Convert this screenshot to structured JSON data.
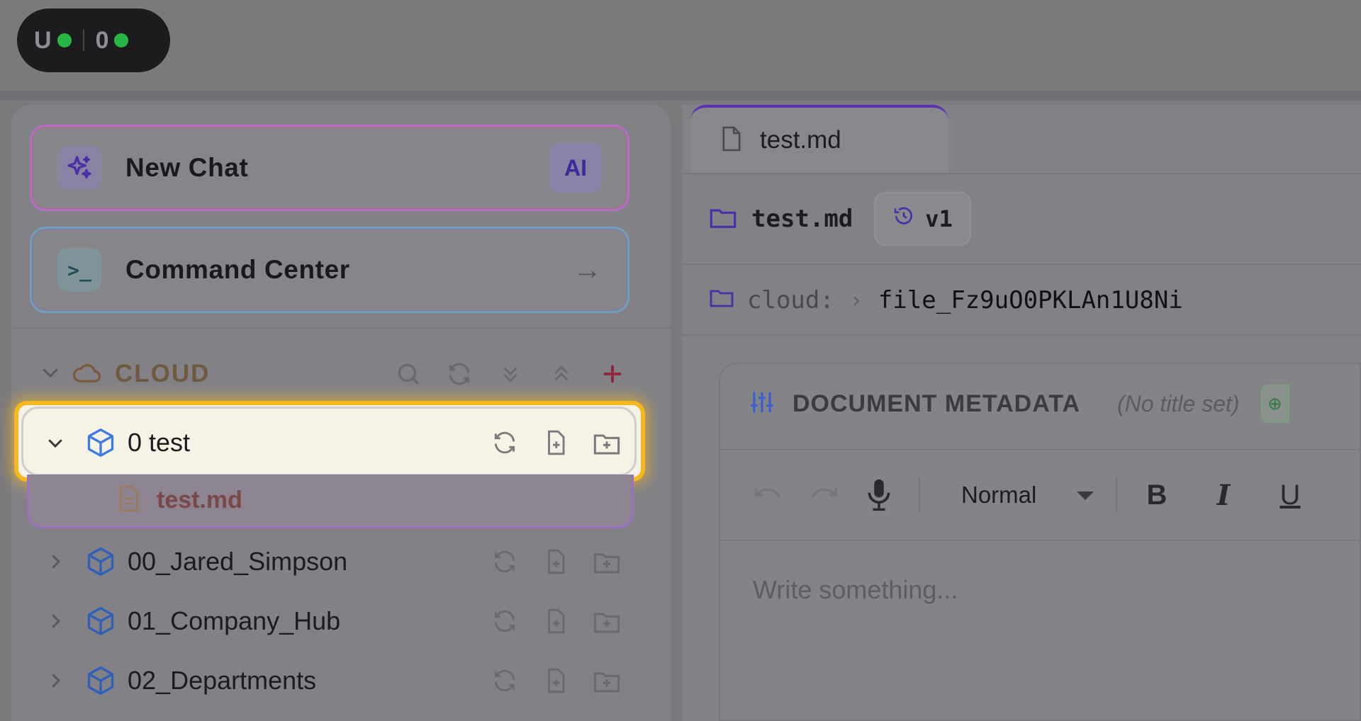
{
  "status": {
    "left_label": "U",
    "right_label": "0",
    "dot_color": "#27b545"
  },
  "sidebar": {
    "new_chat": {
      "label": "New Chat",
      "badge": "AI",
      "icon": "sparkles-icon"
    },
    "command_center": {
      "label": "Command Center",
      "icon": "terminal-icon",
      "arrow": "→"
    },
    "section": {
      "title": "CLOUD",
      "icon": "cloud-icon"
    },
    "tree": [
      {
        "name": "0 test",
        "expanded": true
      },
      {
        "name": "00_Jared_Simpson",
        "expanded": false
      },
      {
        "name": "01_Company_Hub",
        "expanded": false
      },
      {
        "name": "02_Departments",
        "expanded": false
      }
    ],
    "file": {
      "name": "test.md"
    }
  },
  "editor": {
    "tab_label": "test.md",
    "doc_title": "test.md",
    "version": "v1",
    "path": {
      "root": "cloud:",
      "separator": "›",
      "file": "file_Fz9uO0PKLAn1U8Ni"
    },
    "metadata": {
      "title": "DOCUMENT METADATA",
      "subtitle": "(No title set)"
    },
    "toolbar": {
      "style": "Normal",
      "bold": "B",
      "italic": "I",
      "underline": "U"
    },
    "placeholder": "Write something..."
  },
  "colors": {
    "highlight": "#f5b820",
    "accent_purple": "#5a32b0",
    "folder_blue": "#3b7be0"
  }
}
